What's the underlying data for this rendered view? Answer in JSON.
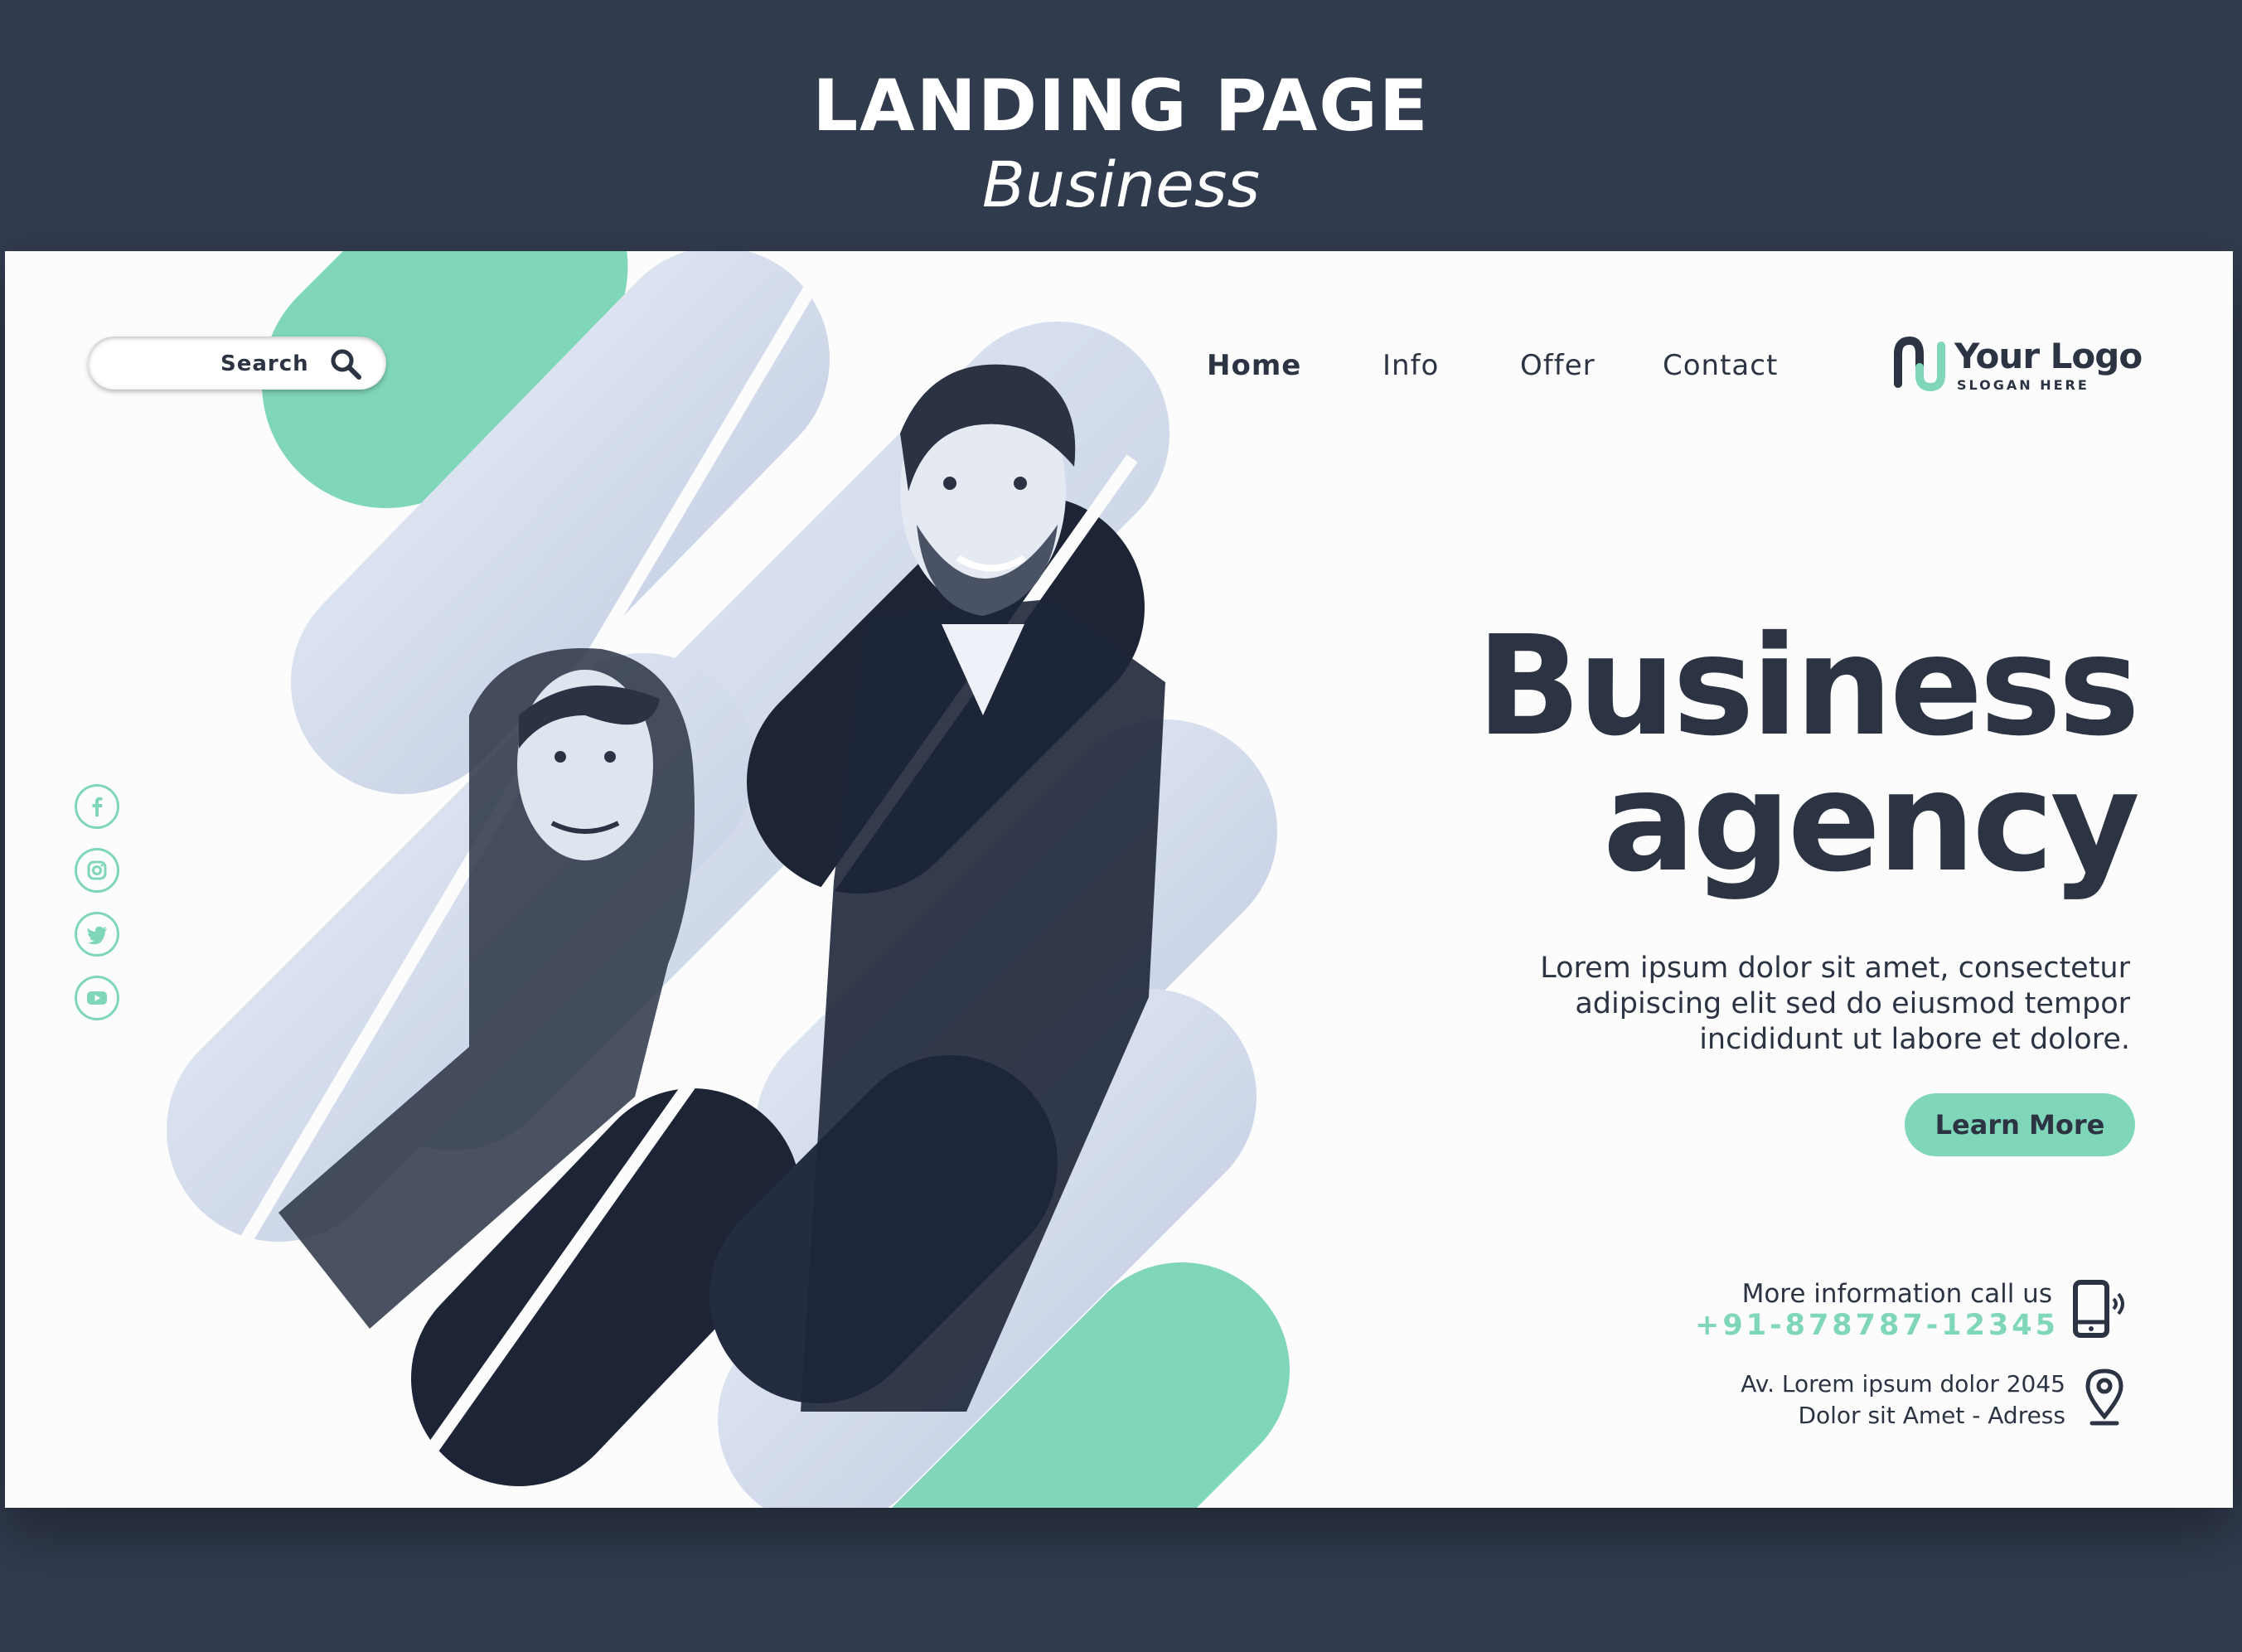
{
  "header": {
    "title": "LANDING PAGE",
    "subtitle": "Business"
  },
  "search": {
    "label": "Search"
  },
  "nav": [
    {
      "label": "Home",
      "active": true
    },
    {
      "label": "Info",
      "active": false
    },
    {
      "label": "Offer",
      "active": false
    },
    {
      "label": "Contact",
      "active": false
    }
  ],
  "logo": {
    "name": "Your Logo",
    "slogan": "SLOGAN HERE"
  },
  "social": [
    "facebook-icon",
    "instagram-icon",
    "twitter-icon",
    "youtube-icon"
  ],
  "hero": {
    "title_line1": "Business",
    "title_line2": "agency",
    "description_line1": "Lorem ipsum dolor sit amet, consectetur",
    "description_line2": "adipiscing elit sed do eiusmod tempor",
    "description_line3": "incididunt ut labore et dolore.",
    "cta_label": "Learn More"
  },
  "contact": {
    "label": "More information call us",
    "phone": "+91-878787-12345",
    "address_line1": "Av. Lorem ipsum dolor 2045",
    "address_line2": "Dolor sit Amet - Adress"
  },
  "colors": {
    "background": "#313b4e",
    "accent": "#7fd6b9",
    "text": "#2c3443",
    "page": "#fcfcfd"
  }
}
